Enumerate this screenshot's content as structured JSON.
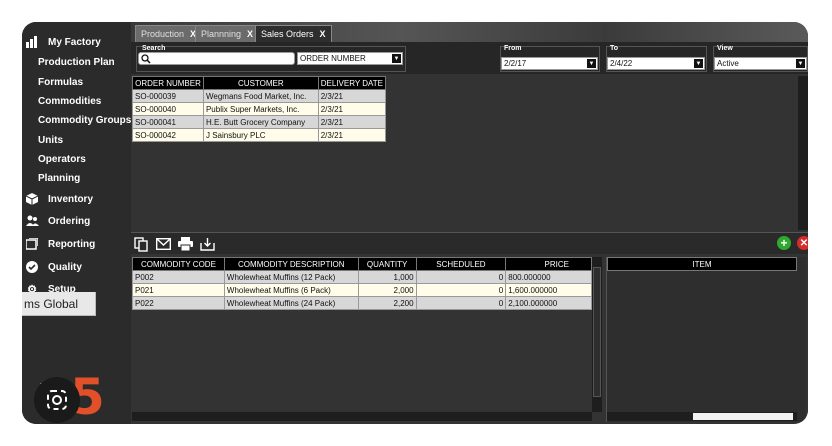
{
  "sidebar": {
    "items": [
      {
        "label": "My Factory",
        "icon": "bar-chart-icon",
        "level": "top"
      },
      {
        "label": "Production Plan",
        "level": "sub"
      },
      {
        "label": "Formulas",
        "level": "sub"
      },
      {
        "label": "Commodities",
        "level": "sub"
      },
      {
        "label": "Commodity Groups",
        "level": "sub"
      },
      {
        "label": "Units",
        "level": "sub"
      },
      {
        "label": "Operators",
        "level": "sub"
      },
      {
        "label": "Planning",
        "level": "sub"
      },
      {
        "label": "Inventory",
        "icon": "box-icon",
        "level": "top"
      },
      {
        "label": "Ordering",
        "icon": "users-icon",
        "level": "top"
      },
      {
        "label": "Reporting",
        "icon": "reporting-icon",
        "level": "top"
      },
      {
        "label": "Quality",
        "icon": "check-circle-icon",
        "level": "top"
      },
      {
        "label": "Setup",
        "icon": "gear-icon",
        "level": "top"
      }
    ],
    "tooltip": "ms Global",
    "logo_text": "5"
  },
  "tabs": [
    {
      "label": "Production",
      "close": "X"
    },
    {
      "label": "Plannning",
      "close": "X"
    },
    {
      "label": "Sales Orders",
      "close": "X"
    }
  ],
  "search": {
    "label": "Search",
    "value": "",
    "field": "ORDER NUMBER",
    "from_label": "From",
    "from_value": "2/2/17",
    "to_label": "To",
    "to_value": "2/4/22",
    "view_label": "View",
    "view_value": "Active"
  },
  "orders": {
    "columns": [
      "ORDER NUMBER",
      "CUSTOMER",
      "DELIVERY DATE"
    ],
    "rows": [
      [
        "SO-000039",
        "Wegmans Food Market, Inc.",
        "2/3/21"
      ],
      [
        "SO-000040",
        "Publix Super Markets, Inc.",
        "2/3/21"
      ],
      [
        "SO-000041",
        "H.E. Butt Grocery Company",
        "2/3/21"
      ],
      [
        "SO-000042",
        "J Sainsbury PLC",
        "2/3/21"
      ]
    ]
  },
  "lines": {
    "columns": [
      "COMMODITY CODE",
      "COMMODITY DESCRIPTION",
      "QUANTITY",
      "SCHEDULED",
      "PRICE"
    ],
    "rows": [
      [
        "P002",
        "Wholewheat Muffins (12 Pack)",
        "1,000",
        "0",
        "800.000000"
      ],
      [
        "P021",
        "Wholewheat Muffins (6 Pack)",
        "2,000",
        "0",
        "1,600.000000"
      ],
      [
        "P022",
        "Wholewheat Muffins (24 Pack)",
        "2,200",
        "0",
        "2,100.000000"
      ]
    ]
  },
  "item_panel": {
    "header": "ITEM"
  },
  "colors": {
    "accent": "#e2502a",
    "add": "#2fa82f",
    "delete": "#d62b2b"
  }
}
